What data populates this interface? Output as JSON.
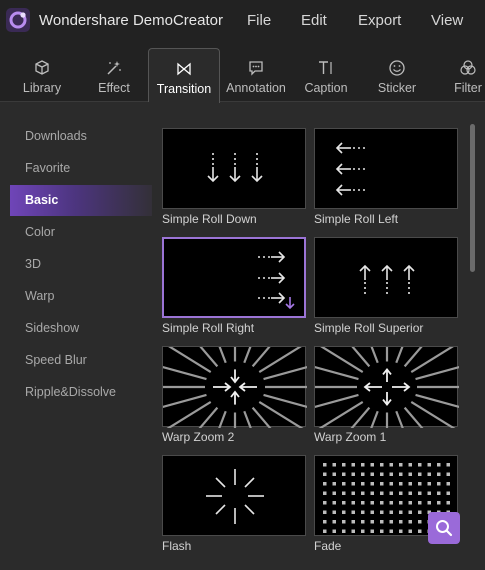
{
  "app": {
    "title": "Wondershare DemoCreator",
    "accent": "#8e5fd3"
  },
  "menu": [
    "File",
    "Edit",
    "Export",
    "View"
  ],
  "tabs": [
    {
      "label": "Library",
      "icon": "cube-icon"
    },
    {
      "label": "Effect",
      "icon": "magic-wand-icon"
    },
    {
      "label": "Transition",
      "icon": "bowtie-transition-icon",
      "active": true
    },
    {
      "label": "Annotation",
      "icon": "speech-bubble-icon"
    },
    {
      "label": "Caption",
      "icon": "text-caption-icon"
    },
    {
      "label": "Sticker",
      "icon": "smiley-icon"
    },
    {
      "label": "Filter",
      "icon": "circles-filter-icon"
    }
  ],
  "sidebar": {
    "items": [
      "Downloads",
      "Favorite",
      "Basic",
      "Color",
      "3D",
      "Warp",
      "Sideshow",
      "Speed Blur",
      "Ripple&Dissolve"
    ],
    "active": "Basic"
  },
  "transitions": [
    {
      "label": "Simple Roll Down",
      "icon": "arrows-down-icon"
    },
    {
      "label": "Simple Roll Left",
      "icon": "arrows-left-icon"
    },
    {
      "label": "Simple Roll Right",
      "icon": "arrows-right-icon",
      "selected": true
    },
    {
      "label": "Simple Roll Superior",
      "icon": "arrows-up-icon"
    },
    {
      "label": "Warp Zoom 2",
      "icon": "warp-zoom-in-icon"
    },
    {
      "label": "Warp Zoom 1",
      "icon": "warp-zoom-out-icon"
    },
    {
      "label": "Flash",
      "icon": "flash-burst-icon"
    },
    {
      "label": "Fade",
      "icon": "dot-grid-icon"
    }
  ],
  "search_button": {
    "icon": "search-icon"
  }
}
